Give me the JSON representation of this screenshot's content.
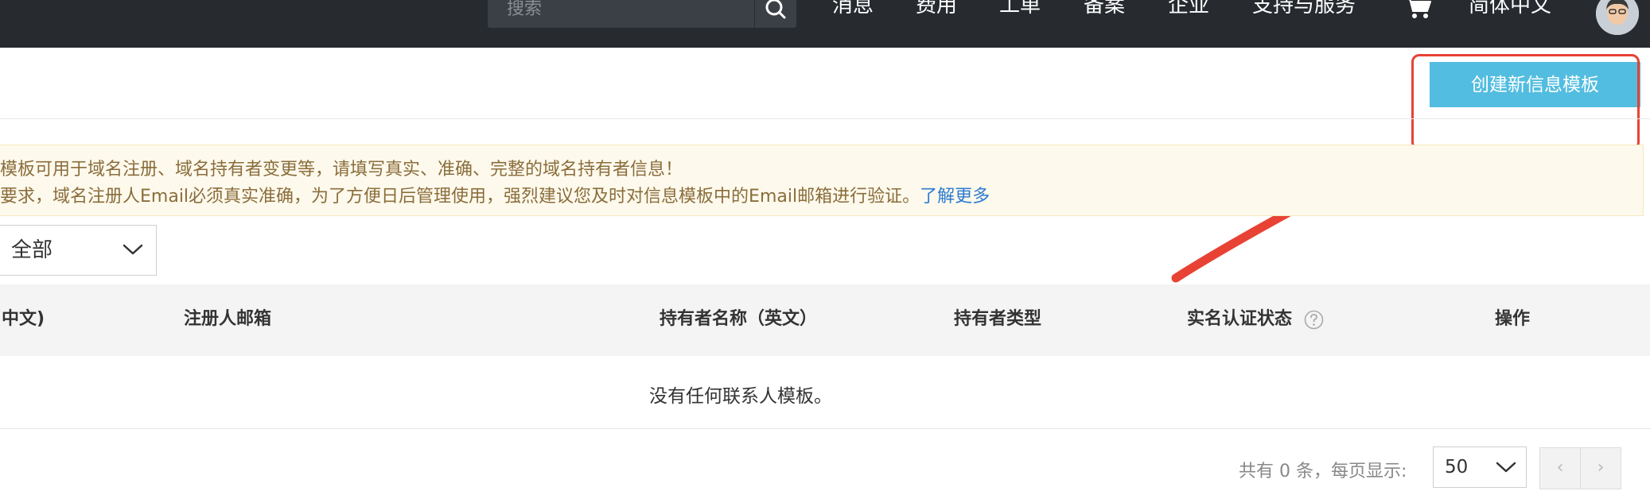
{
  "topbar": {
    "search_placeholder": "搜索",
    "nav": [
      "消息",
      "费用",
      "工单",
      "备案",
      "企业",
      "支持与服务",
      "简体中文"
    ]
  },
  "toolbar": {
    "create_label": "创建新信息模板"
  },
  "notice": {
    "line1": "模板可用于域名注册、域名持有者变更等，请填写真实、准确、完整的域名持有者信息！",
    "line2": "要求，域名注册人Email必须真实准确，为了方便日后管理使用，强烈建议您及时对信息模板中的Email邮箱进行验证。",
    "link": "了解更多"
  },
  "filter": {
    "value": "全部"
  },
  "table": {
    "headers": [
      "(中文)",
      "注册人邮箱",
      "持有者名称（英文）",
      "持有者类型",
      "实名认证状态",
      "操作"
    ],
    "empty": "没有任何联系人模板。"
  },
  "pagination": {
    "summary": "共有 0 条，每页显示:",
    "page_size": "50",
    "prev": "‹",
    "next": "›"
  },
  "colors": {
    "accent": "#52bde0",
    "highlight": "#e84235",
    "topbar": "#272b30"
  }
}
